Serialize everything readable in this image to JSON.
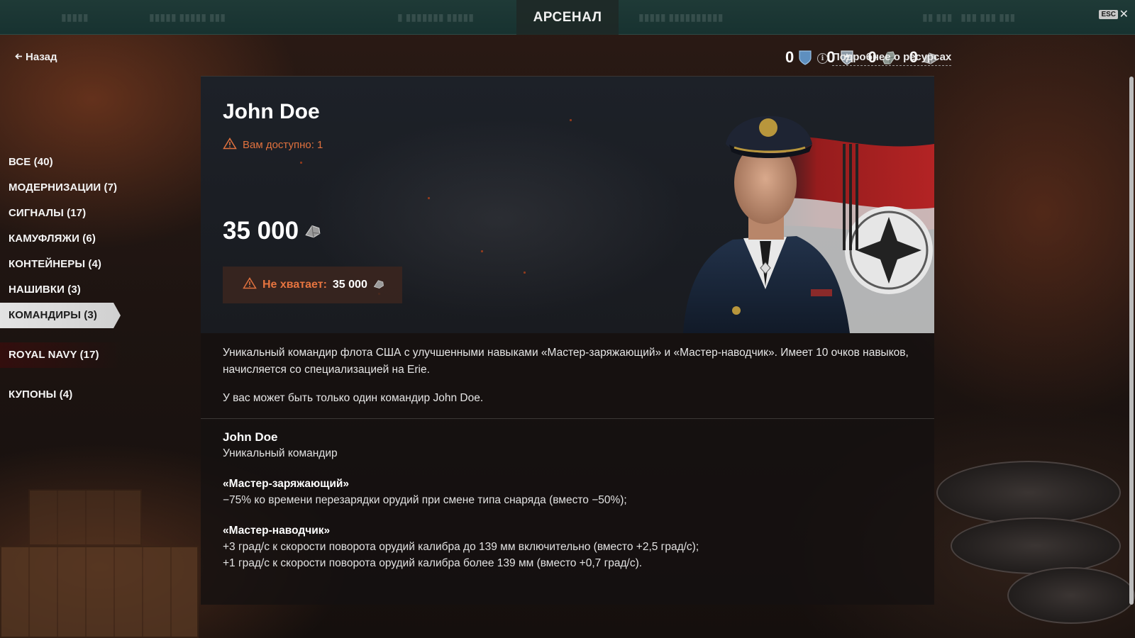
{
  "header": {
    "title": "АРСЕНАЛ",
    "esc_label": "ESC",
    "close_glyph": "✕"
  },
  "back": {
    "arrow": "🡐",
    "label": "Назад"
  },
  "resources": {
    "items": [
      {
        "value": "0",
        "icon": "shield-icon"
      },
      {
        "value": "0",
        "icon": "crown-shield-icon"
      },
      {
        "value": "0",
        "icon": "coal-icon"
      },
      {
        "value": "0",
        "icon": "steel-icon"
      }
    ],
    "more_label": "Подробнее о ресурсах",
    "info_glyph": "i"
  },
  "nav": {
    "items": [
      {
        "label": "ВСЕ (40)"
      },
      {
        "label": "МОДЕРНИЗАЦИИ (7)"
      },
      {
        "label": "СИГНАЛЫ (17)"
      },
      {
        "label": "КАМУФЛЯЖИ (6)"
      },
      {
        "label": "КОНТЕЙНЕРЫ (4)"
      },
      {
        "label": "НАШИВКИ (3)"
      },
      {
        "label": "КОМАНДИРЫ (3)",
        "active": true
      },
      {
        "label": "ROYAL NAVY (17)"
      },
      {
        "label": "КУПОНЫ (4)"
      }
    ]
  },
  "item": {
    "name": "John Doe",
    "available_text": "Вам доступно: 1",
    "price": "35 000",
    "lack_label": "Не хватает:",
    "lack_value": "35 000",
    "description": [
      "Уникальный командир флота США с улучшенными навыками «Мастер-заряжающий» и «Мастер-наводчик». Имеет 10 очков навыков, начисляется со специализацией на Erie.",
      "У вас может быть только один командир John Doe."
    ],
    "details": {
      "name": "John Doe",
      "subtitle": "Уникальный командир",
      "skills": [
        {
          "title": "«Мастер-заряжающий»",
          "lines": [
            "−75% ко времени перезарядки орудий при смене типа снаряда (вместо −50%);"
          ]
        },
        {
          "title": "«Мастер-наводчик»",
          "lines": [
            "+3 град/с к скорости поворота орудий калибра до 139 мм включительно (вместо +2,5 град/с);",
            "+1 град/с к скорости поворота орудий калибра более 139 мм (вместо +0,7 град/с)."
          ]
        }
      ]
    }
  },
  "colors": {
    "accent_warning": "#e0713e",
    "topbar": "#1f3a37",
    "active_nav": "#e3e3e3"
  }
}
